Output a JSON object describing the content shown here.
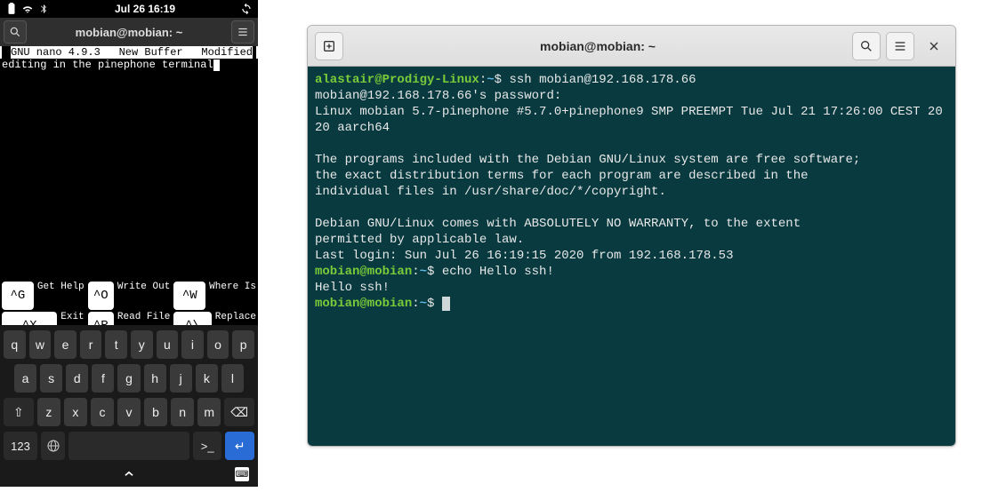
{
  "phone": {
    "statusbar": {
      "time": "Jul 26  16:19"
    },
    "titlebar": {
      "title": "mobian@mobian: ~"
    },
    "nano": {
      "version": "GNU nano 4.9.3",
      "buffer_label": "New Buffer",
      "modified_label": "Modified",
      "text": "editing in the pinephone terminal",
      "help": {
        "getHelp": "Get Help",
        "exit": "Exit",
        "writeOut": "Write Out",
        "readFile": "Read File",
        "whereIs": "Where Is",
        "replace": "Replace"
      },
      "keys": {
        "getHelp": "^G",
        "exit": "^X",
        "writeOut": "^O",
        "readFile": "^R",
        "whereIs": "^W",
        "replace": "^\\"
      }
    },
    "keyboard": {
      "row1": [
        "q",
        "w",
        "e",
        "r",
        "t",
        "y",
        "u",
        "i",
        "o",
        "p"
      ],
      "row2": [
        "a",
        "s",
        "d",
        "f",
        "g",
        "h",
        "j",
        "k",
        "l"
      ],
      "row3": [
        "z",
        "x",
        "c",
        "v",
        "b",
        "n",
        "m"
      ],
      "shift": "⇧",
      "backspace": "⌫",
      "numKey": "123",
      "globe": "🌐",
      "termKey": ">_",
      "enter": "↵"
    }
  },
  "desktop": {
    "titlebar": {
      "title": "mobian@mobian: ~"
    },
    "lines": {
      "p1_user": "alastair@Prodigy-Linux",
      "p1_path": "~",
      "p1_cmd": "ssh mobian@192.168.178.66",
      "pwprompt": "mobian@192.168.178.66's password:",
      "uname": "Linux mobian 5.7-pinephone #5.7.0+pinephone9 SMP PREEMPT Tue Jul 21 17:26:00 CEST 2020 aarch64",
      "motd1": "The programs included with the Debian GNU/Linux system are free software;",
      "motd2": "the exact distribution terms for each program are described in the",
      "motd3": "individual files in /usr/share/doc/*/copyright.",
      "motd4": "Debian GNU/Linux comes with ABSOLUTELY NO WARRANTY, to the extent",
      "motd5": "permitted by applicable law.",
      "lastlogin": "Last login: Sun Jul 26 16:19:15 2020 from 192.168.178.53",
      "p2_user": "mobian@mobian",
      "p2_path": "~",
      "p2_cmd": "echo Hello ssh!",
      "echoout": "Hello ssh!",
      "p3_user": "mobian@mobian",
      "p3_path": "~"
    }
  }
}
